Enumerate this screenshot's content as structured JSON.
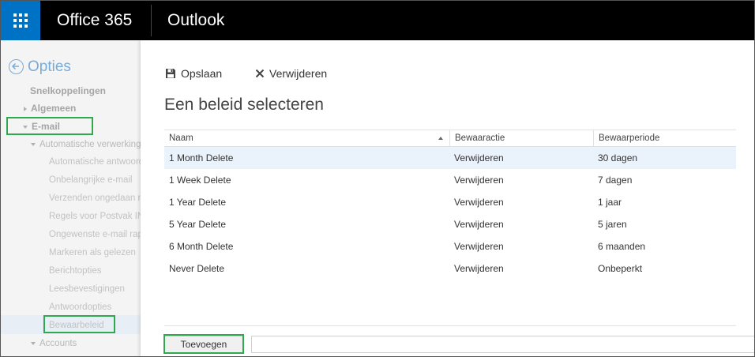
{
  "topbar": {
    "brand": "Office 365",
    "app": "Outlook"
  },
  "sidebar": {
    "back_label": "Opties",
    "items": [
      {
        "label": "Snelkoppelingen"
      },
      {
        "label": "Algemeen"
      },
      {
        "label": "E-mail"
      },
      {
        "label": "Automatische verwerking"
      },
      {
        "label": "Automatische antwoorden"
      },
      {
        "label": "Onbelangrijke e-mail"
      },
      {
        "label": "Verzenden ongedaan maken"
      },
      {
        "label": "Regels voor Postvak IN"
      },
      {
        "label": "Ongewenste e-mail rapporteren"
      },
      {
        "label": "Markeren als gelezen"
      },
      {
        "label": "Berichtopties"
      },
      {
        "label": "Leesbevestigingen"
      },
      {
        "label": "Antwoordopties"
      },
      {
        "label": "Bewaarbeleid"
      },
      {
        "label": "Accounts"
      }
    ]
  },
  "toolbar": {
    "save_label": "Opslaan",
    "delete_label": "Verwijderen"
  },
  "main": {
    "title": "Een beleid selecteren",
    "columns": [
      "Naam",
      "Bewaaractie",
      "Bewaarperiode"
    ],
    "rows": [
      {
        "name": "1 Month Delete",
        "action": "Verwijderen",
        "period": "30 dagen"
      },
      {
        "name": "1 Week Delete",
        "action": "Verwijderen",
        "period": "7 dagen"
      },
      {
        "name": "1 Year Delete",
        "action": "Verwijderen",
        "period": "1 jaar"
      },
      {
        "name": "5 Year Delete",
        "action": "Verwijderen",
        "period": "5 jaren"
      },
      {
        "name": "6 Month Delete",
        "action": "Verwijderen",
        "period": "6 maanden"
      },
      {
        "name": "Never Delete",
        "action": "Verwijderen",
        "period": "Onbeperkt"
      }
    ],
    "add_label": "Toevoegen"
  },
  "colors": {
    "topbar": "#000000",
    "waffle": "#0072c6",
    "accent_link": "#7aabd6",
    "highlight_box": "#2fa84f",
    "selected_row": "#eaf2fb"
  },
  "icons": {
    "waffle": "app-launcher-icon",
    "back": "back-arrow-icon",
    "save": "floppy-disk-icon",
    "delete": "x-icon",
    "sort": "sort-ascending-icon"
  }
}
